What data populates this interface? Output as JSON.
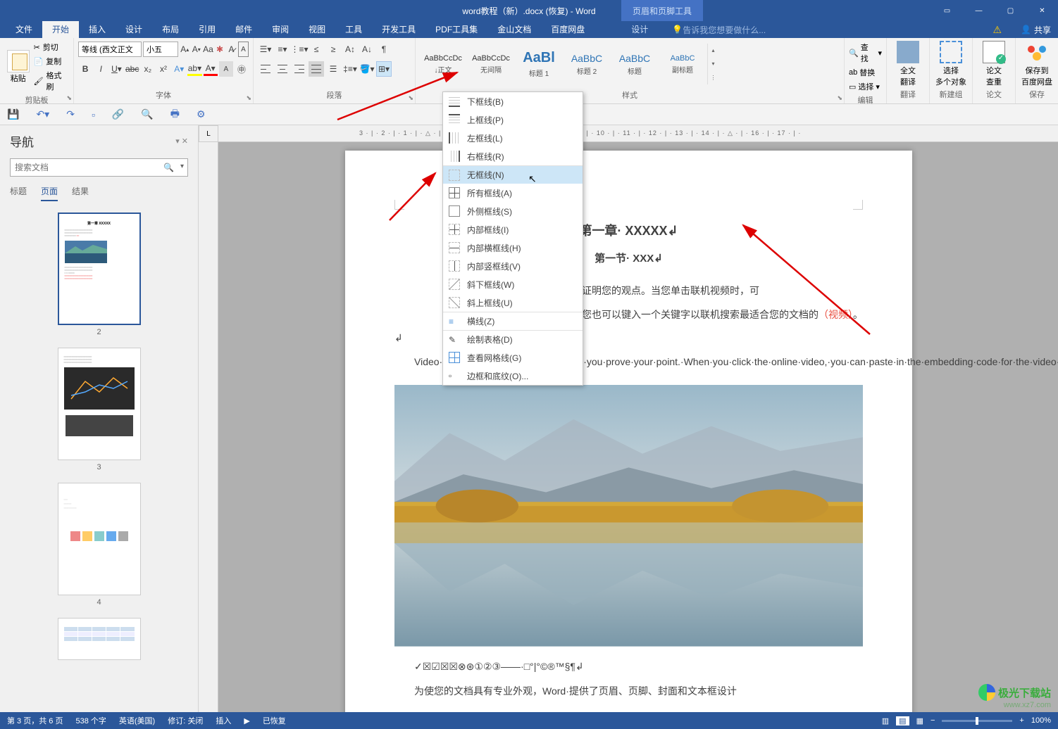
{
  "titlebar": {
    "filename": "word教程（新）.docx (恢复) - Word",
    "context_tab": "页眉和页脚工具"
  },
  "window_controls": {
    "box": "▭",
    "min": "—",
    "max": "▢",
    "close": "✕"
  },
  "tabs": {
    "file": "文件",
    "home": "开始",
    "insert": "插入",
    "design_page": "设计",
    "layout": "布局",
    "references": "引用",
    "mail": "邮件",
    "review": "审阅",
    "view": "视图",
    "tools": "工具",
    "dev": "开发工具",
    "pdf": "PDF工具集",
    "wps": "金山文档",
    "baidu": "百度网盘",
    "design": "设计",
    "tellme": "告诉我您想要做什么...",
    "share": "共享"
  },
  "clipboard": {
    "paste": "粘贴",
    "cut": "剪切",
    "copy": "复制",
    "painter": "格式刷",
    "label": "剪贴板"
  },
  "font": {
    "family": "等线 (西文正文",
    "size": "小五",
    "label": "字体"
  },
  "paragraph": {
    "label": "段落"
  },
  "styles": {
    "label": "样式",
    "items": [
      {
        "preview": "AaBbCcDc",
        "name": "↓正文",
        "cls": ""
      },
      {
        "preview": "AaBbCcDc",
        "name": "无间隔",
        "cls": ""
      },
      {
        "preview": "AaBl",
        "name": "标题 1",
        "cls": "big"
      },
      {
        "preview": "AaBbC",
        "name": "标题 2",
        "cls": "h2"
      },
      {
        "preview": "AaBbC",
        "name": "标题",
        "cls": "h2"
      },
      {
        "preview": "AaBbC",
        "name": "副标题",
        "cls": "blue"
      }
    ]
  },
  "editing": {
    "find": "查找",
    "replace": "替换",
    "select": "选择",
    "label": "编辑"
  },
  "groups": {
    "translate": {
      "l1": "全文",
      "l2": "翻译",
      "label": "翻译"
    },
    "select_multi": {
      "l1": "选择",
      "l2": "多个对象",
      "label": "新建组"
    },
    "thesis": {
      "l1": "论文",
      "l2": "查重",
      "label": "论文"
    },
    "save_baidu": {
      "l1": "保存到",
      "l2": "百度网盘",
      "label": "保存"
    }
  },
  "nav": {
    "title": "导航",
    "search_placeholder": "搜索文档",
    "tab_headings": "标题",
    "tab_pages": "页面",
    "tab_results": "结果",
    "pages": [
      "2",
      "3",
      "4"
    ]
  },
  "border_menu": {
    "bottom": "下框线(B)",
    "top": "上框线(P)",
    "left": "左框线(L)",
    "right_b": "右框线(R)",
    "none": "无框线(N)",
    "all": "所有框线(A)",
    "outside": "外侧框线(S)",
    "inside": "内部框线(I)",
    "inside_h": "内部横框线(H)",
    "inside_v": "内部竖框线(V)",
    "diag_down": "斜下框线(W)",
    "diag_up": "斜上框线(U)",
    "hline": "横线(Z)",
    "draw": "绘制表格(D)",
    "grid": "查看网格线(G)",
    "dialog": "边框和底纹(O)..."
  },
  "ruler_h": "3 · | · 2 · | · 1 · | · △ · | · 1 ·                                                           4 · | · 5 · | · 6 · | · 7 · △ · 8 · | · 9 · | · 10 · | · 11 · | · 12 · | · 13 · | · 14 · | · △ · | · 16 · | · 17 · | ·",
  "document": {
    "title": "第一章· XXXXX↲",
    "subtitle": "第一节· XXX↲",
    "para1_pre": "强大的方法帮助您证明您的观点。当您单击联机视频时，可",
    "para1_mid": "的嵌入代码中进行粘贴。您也可以键入一个关键字以联机搜索最适合您的文档的",
    "para1_red": "（视频）",
    "para1_end": "。↲",
    "para2": "Video·provides·a·powerful·way·to·help·you·prove·your·point.·When·you·click·the·online·video,·you·can·paste·in·the·embedding·code·for·the·video·you·want·to·add.·You·can·also·type·a·keyword·to·search·online·for·the·video·that·best·fits·your·document.↲",
    "symbols": "✓☒☑☒☒⊗⊛①②③——·□°|°©®™§¶↲",
    "para3": "为使您的文档具有专业外观，Word·提供了页眉、页脚、封面和文本框设计"
  },
  "statusbar": {
    "page": "第 3 页，共 6 页",
    "words": "538 个字",
    "lang": "英语(美国)",
    "track": "修订: 关闭",
    "insert": "插入",
    "recovered": "已恢复",
    "zoom": "100%"
  },
  "watermark": {
    "name": "极光下载站",
    "url": "www.xz7.com"
  }
}
